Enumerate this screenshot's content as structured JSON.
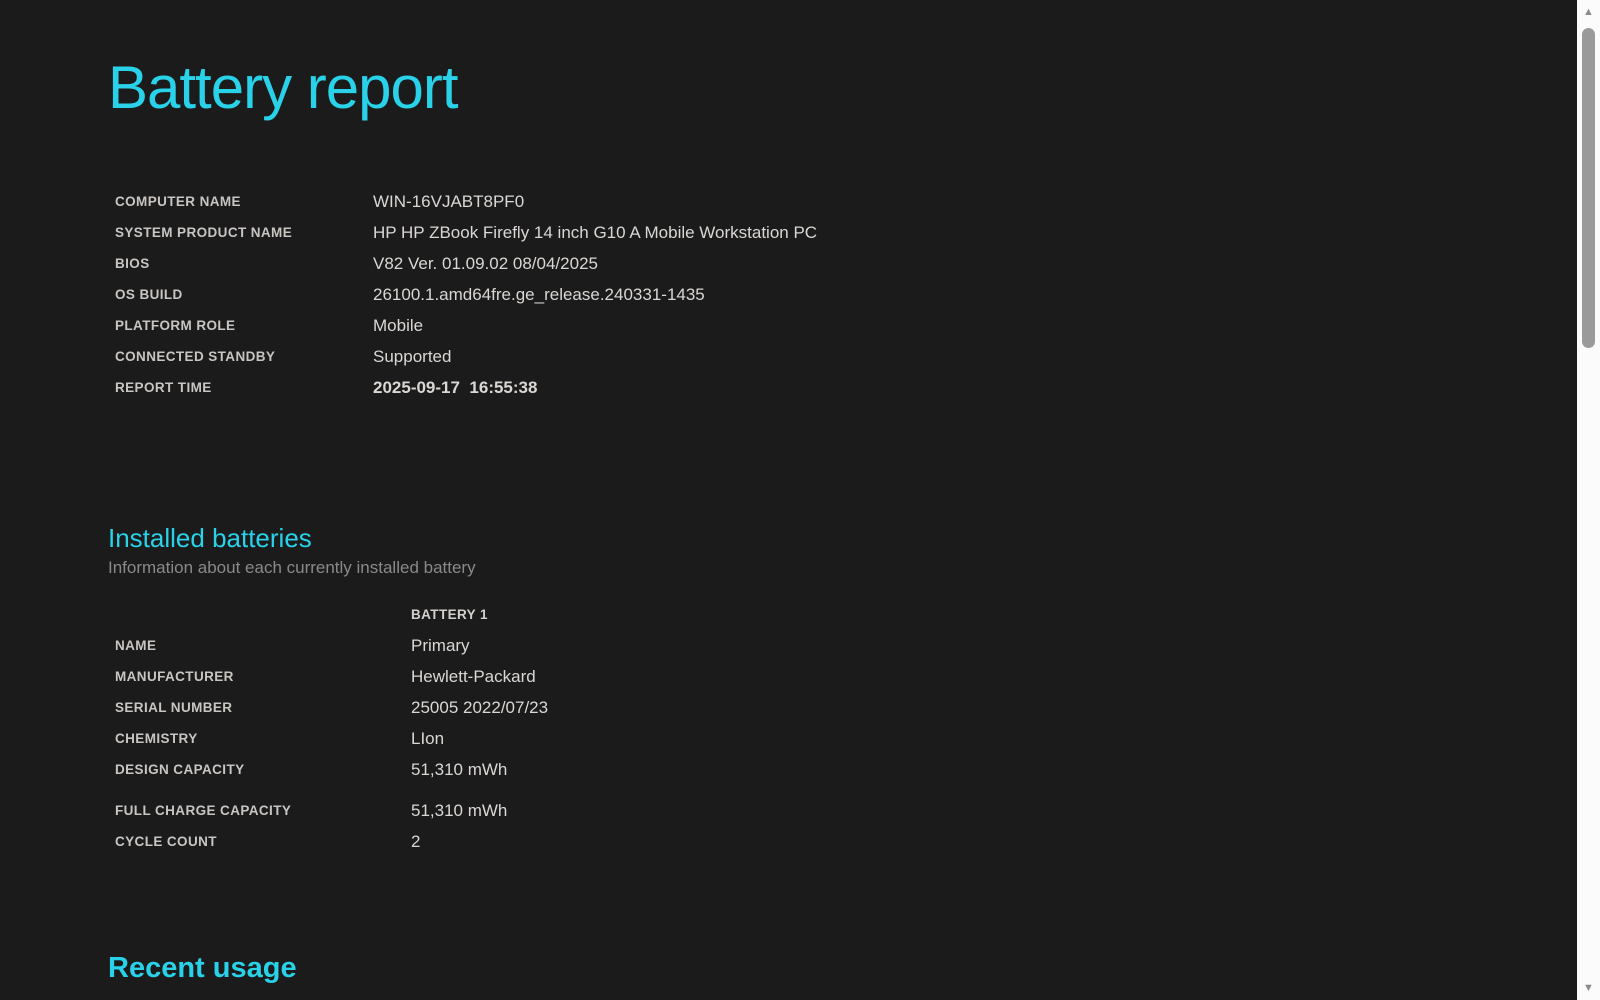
{
  "page": {
    "title": "Battery report"
  },
  "colors": {
    "background": "#1b1b1b",
    "accent": "#29d2e8",
    "label_text": "#c8c5c2",
    "value_text": "#dad7d4",
    "subtitle_text": "#8b8987",
    "scrollbar_track": "#fbfbfb",
    "scrollbar_thumb": "#9a9a9a"
  },
  "system_info": {
    "rows": [
      {
        "label": "COMPUTER NAME",
        "value": "WIN-16VJABT8PF0"
      },
      {
        "label": "SYSTEM PRODUCT NAME",
        "value": "HP HP ZBook Firefly 14 inch G10 A Mobile Workstation PC"
      },
      {
        "label": "BIOS",
        "value": "V82 Ver. 01.09.02 08/04/2025"
      },
      {
        "label": "OS BUILD",
        "value": "26100.1.amd64fre.ge_release.240331-1435"
      },
      {
        "label": "PLATFORM ROLE",
        "value": "Mobile"
      },
      {
        "label": "CONNECTED STANDBY",
        "value": "Supported"
      },
      {
        "label": "REPORT TIME",
        "value": "2025-09-17  16:55:38"
      }
    ]
  },
  "installed_batteries": {
    "heading": "Installed batteries",
    "subtitle": "Information about each currently installed battery",
    "column_header": "BATTERY 1",
    "rows": [
      {
        "label": "NAME",
        "value": "Primary"
      },
      {
        "label": "MANUFACTURER",
        "value": "Hewlett-Packard"
      },
      {
        "label": "SERIAL NUMBER",
        "value": "25005 2022/07/23"
      },
      {
        "label": "CHEMISTRY",
        "value": "LIon"
      },
      {
        "label": "DESIGN CAPACITY",
        "value": "51,310 mWh"
      },
      {
        "label": "FULL CHARGE CAPACITY",
        "value": "51,310 mWh"
      },
      {
        "label": "CYCLE COUNT",
        "value": "2"
      }
    ]
  },
  "recent_usage": {
    "heading": "Recent usage"
  },
  "scrollbar": {
    "up_icon": "▲",
    "down_icon": "▼"
  }
}
